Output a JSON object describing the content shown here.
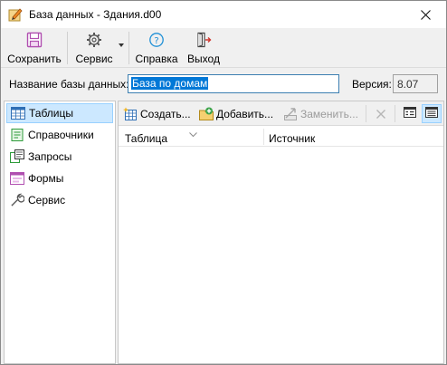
{
  "window": {
    "title": "База данных - Здания.d00"
  },
  "toolbar": {
    "save_label": "Сохранить",
    "service_label": "Сервис",
    "help_label": "Справка",
    "exit_label": "Выход"
  },
  "db": {
    "name_label": "Название базы данных:",
    "name_value": "База по домам",
    "version_label": "Версия:",
    "version_value": "8.07"
  },
  "sidebar": {
    "items": [
      {
        "label": "Таблицы",
        "icon": "table-icon",
        "active": true
      },
      {
        "label": "Справочники",
        "icon": "reference-icon",
        "active": false
      },
      {
        "label": "Запросы",
        "icon": "query-icon",
        "active": false
      },
      {
        "label": "Формы",
        "icon": "form-icon",
        "active": false
      },
      {
        "label": "Сервис",
        "icon": "wrench-icon",
        "active": false
      }
    ]
  },
  "panel": {
    "create_label": "Создать...",
    "add_label": "Добавить...",
    "replace_label": "Заменить...",
    "columns": [
      "Таблица",
      "Источник"
    ]
  },
  "colors": {
    "selection": "#0078d7",
    "active_item_bg": "#cce8ff",
    "active_item_border": "#99d1ff"
  }
}
